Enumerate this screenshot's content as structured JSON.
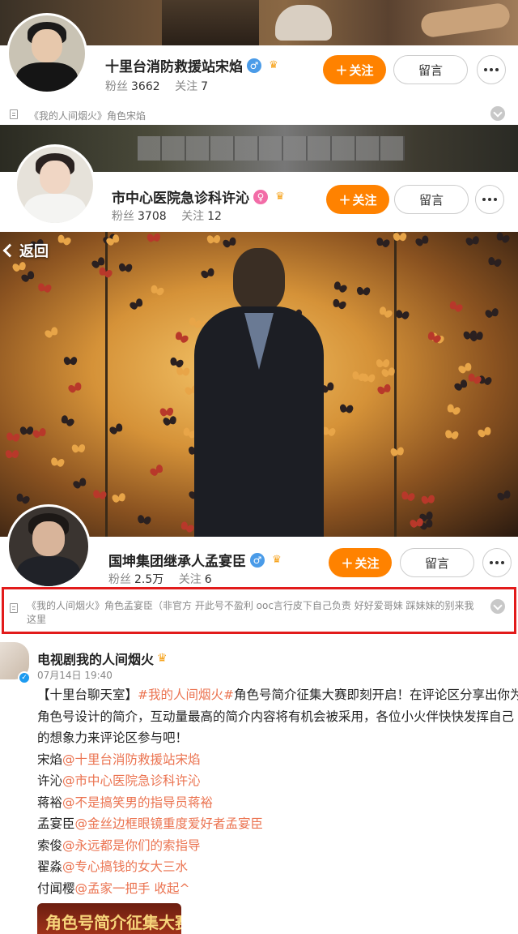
{
  "nav": {
    "back_label": "返回"
  },
  "profiles": [
    {
      "name": "十里台消防救援站宋焰",
      "gender": "male",
      "fans_label": "粉丝",
      "fans": "3662",
      "follow_label": "关注",
      "follow": "7",
      "follow_button": "关注",
      "message_button": "留言",
      "description": "《我的人间烟火》角色宋焰"
    },
    {
      "name": "市中心医院急诊科许沁",
      "gender": "female",
      "fans_label": "粉丝",
      "fans": "3708",
      "follow_label": "关注",
      "follow": "12",
      "follow_button": "关注",
      "message_button": "留言"
    },
    {
      "name": "国坤集团继承人孟宴臣",
      "gender": "male",
      "fans_label": "粉丝",
      "fans": "2.5万",
      "follow_label": "关注",
      "follow": "6",
      "follow_button": "关注",
      "message_button": "留言",
      "description": "《我的人间烟火》角色孟宴臣（非官方 开此号不盈利 ooc言行皮下自己负责 好好爱哥妹 踩妹妹的别来我这里"
    }
  ],
  "post": {
    "author": "电视剧我的人间烟火",
    "time": "07月14日 19:40",
    "intro_prefix": "【十里台聊天室】",
    "hashtag": "#我的人间烟火#",
    "intro_line1_rest": "角色号简介征集大赛即刻开启！在评论区分享出你为",
    "intro_line2": "角色号设计的简介，互动量最高的简介内容将有机会被采用，各位小火伴快快发挥自己",
    "intro_line3": "的想象力来评论区参与吧！",
    "mentions": [
      {
        "role": "宋焰",
        "handle": "@十里台消防救援站宋焰"
      },
      {
        "role": "许沁",
        "handle": "@市中心医院急诊科许沁"
      },
      {
        "role": "蒋裕",
        "handle": "@不是搞笑男的指导员蒋裕"
      },
      {
        "role": "孟宴臣",
        "handle": "@金丝边框眼镜重度爱好者孟宴臣"
      },
      {
        "role": "索俊",
        "handle": "@永远都是你们的索指导"
      },
      {
        "role": "翟淼",
        "handle": "@专心搞钱的女大三水"
      },
      {
        "role": "付闻樱",
        "handle": "@孟家一把手"
      }
    ],
    "collapse_label": "收起",
    "image_text": "角色号简介征集大赛"
  }
}
